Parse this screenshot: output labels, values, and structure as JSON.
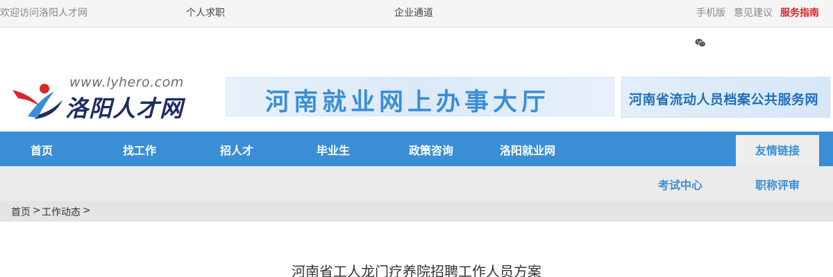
{
  "topbar": {
    "welcome": "欢迎访问洛阳人才网",
    "personal": "个人求职",
    "company": "企业通道",
    "mobile": "手机版",
    "feedback": "意见建议",
    "guide": "服务指南"
  },
  "icons": {
    "wechat": "wechat-icon"
  },
  "logo": {
    "url": "www.lyhero.com",
    "name": "洛阳人才网"
  },
  "banners": {
    "hall": "河南就业网上办事大厅",
    "archives": "河南省流动人员档案公共服务网"
  },
  "nav": {
    "items": [
      "首页",
      "找工作",
      "招人才",
      "毕业生",
      "政策咨询",
      "洛阳就业网"
    ],
    "friend_links": "友情链接"
  },
  "subnav": {
    "items": [
      "考试中心",
      "职称评审"
    ]
  },
  "breadcrumb": {
    "home": "首页",
    "sep1": ">",
    "section": "工作动态",
    "sep2": ">"
  },
  "article": {
    "title": "河南省工人龙门疗养院招聘工作人员方案"
  },
  "colors": {
    "nav_bg": "#3a8ed6",
    "subnav_bg": "#ebebeb",
    "accent_red": "#d9262b",
    "logo_navy": "#1d2c62"
  }
}
